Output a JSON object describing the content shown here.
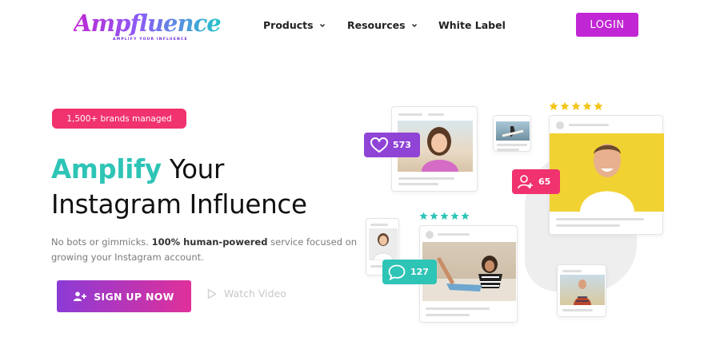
{
  "header": {
    "logo_text": "Ampfluence",
    "logo_tagline": "AMPLIFY YOUR INFLUENCE",
    "nav": [
      {
        "label": "Products",
        "has_dropdown": true
      },
      {
        "label": "Resources",
        "has_dropdown": true
      },
      {
        "label": "White Label",
        "has_dropdown": false
      }
    ],
    "login_label": "LOGIN"
  },
  "hero": {
    "badge": "1,500+ brands managed",
    "title_highlight": "Amplify",
    "title_rest": " Your",
    "title_line2": "Instagram Influence",
    "desc_pre": "No bots or gimmicks. ",
    "desc_bold": "100% human-powered",
    "desc_post": "  service focused on growing your Instagram account.",
    "signup_label": "SIGN UP NOW",
    "watch_label": "Watch Video"
  },
  "illustration": {
    "likes_count": "573",
    "followers_count": "65",
    "comments_count": "127"
  },
  "colors": {
    "accent_purple": "#c026d3",
    "accent_pink": "#f0326e",
    "accent_teal": "#2ec4b6",
    "likes_purple": "#8f44d6",
    "star_yellow": "#f3c315",
    "star_teal": "#2ec4b6"
  },
  "icons": [
    "chevron-down-icon",
    "user-plus-icon",
    "play-icon",
    "heart-icon",
    "comment-icon",
    "star-icon"
  ]
}
